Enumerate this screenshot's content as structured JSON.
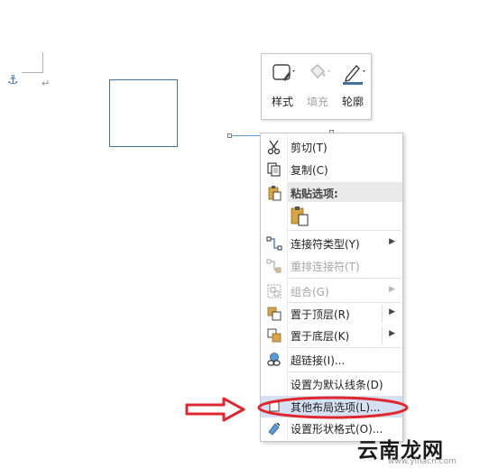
{
  "mini_toolbar": {
    "style_label": "样式",
    "fill_label": "填充",
    "outline_label": "轮廓"
  },
  "menu": {
    "cut": "剪切(T)",
    "copy": "复制(C)",
    "paste_options_header": "粘贴选项:",
    "connector_type": "连接符类型(Y)",
    "reroute_connectors": "重排连接符(T)",
    "group": "组合(G)",
    "bring_to_front": "置于顶层(R)",
    "send_to_back": "置于底层(K)",
    "hyperlink": "超链接(I)...",
    "set_default_line": "设置为默认线条(D)",
    "more_layout_options": "其他布局选项(L)...",
    "format_shape": "设置形状格式(O)..."
  },
  "watermark": {
    "text": "云南龙网",
    "url": "www.ylnacn.com"
  },
  "colors": {
    "accent_blue": "#41719c",
    "annotation_red": "#e0262e",
    "highlight": "#d5e1f2"
  }
}
